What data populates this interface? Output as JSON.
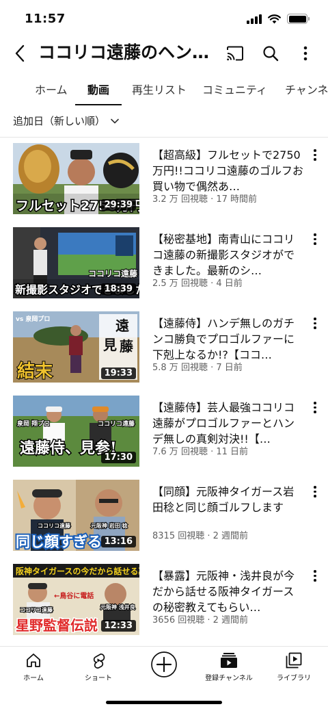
{
  "status_bar": {
    "time": "11:57"
  },
  "header": {
    "title": "ココリコ遠藤のヘン…"
  },
  "tabs": [
    {
      "label": "ホーム"
    },
    {
      "label": "動画"
    },
    {
      "label": "再生リスト"
    },
    {
      "label": "コミュニティ"
    },
    {
      "label": "チャンネル"
    }
  ],
  "sort": {
    "label": "追加日（新しい順）"
  },
  "videos": [
    {
      "title": "【超高級】フルセットで2750万円!!ココリコ遠藤のゴルフお買い物で偶然あ…",
      "meta": "3.2 万 回視聴 · 17 時間前",
      "duration": "29:39",
      "overlay": "フルセット2750万円"
    },
    {
      "title": "【秘密基地】南青山にココリコ遠藤の新撮影スタジオができました。最新のシ…",
      "meta": "2.5 万 回視聴 · 4 日前",
      "duration": "18:39",
      "overlay": "新撮影スタジオできました"
    },
    {
      "title": "【遠藤侍】ハンデ無しのガチンコ勝負でプロゴルファーに下剋上なるか!?【ココ…",
      "meta": "5.8 万 回視聴 · 7 日前",
      "duration": "19:33",
      "overlay": "結末"
    },
    {
      "title": "【遠藤侍】芸人最強ココリコ遠藤がプロゴルファーとハンデ無しの真剣対決!!【…",
      "meta": "7.6 万 回視聴 · 11 日前",
      "duration": "17:30",
      "overlay": "遠藤侍、見参!"
    },
    {
      "title": "【同顔】元阪神タイガース岩田稔と同じ顔ゴルフします",
      "meta": "8315 回視聴 · 2 週間前",
      "duration": "13:16",
      "overlay": "同じ顔すぎる"
    },
    {
      "title": "【暴露】元阪神・浅井良が今だから話せる阪神タイガースの秘密教えてもらい…",
      "meta": "3656 回視聴 · 2 週間前",
      "duration": "12:33",
      "overlay": "星野監督伝説"
    }
  ],
  "bottom_nav": [
    {
      "label": "ホーム",
      "icon": "home-icon"
    },
    {
      "label": "ショート",
      "icon": "shorts-icon"
    },
    {
      "label": "",
      "icon": "create-icon"
    },
    {
      "label": "登録チャンネル",
      "icon": "subscriptions-icon"
    },
    {
      "label": "ライブラリ",
      "icon": "library-icon"
    }
  ]
}
